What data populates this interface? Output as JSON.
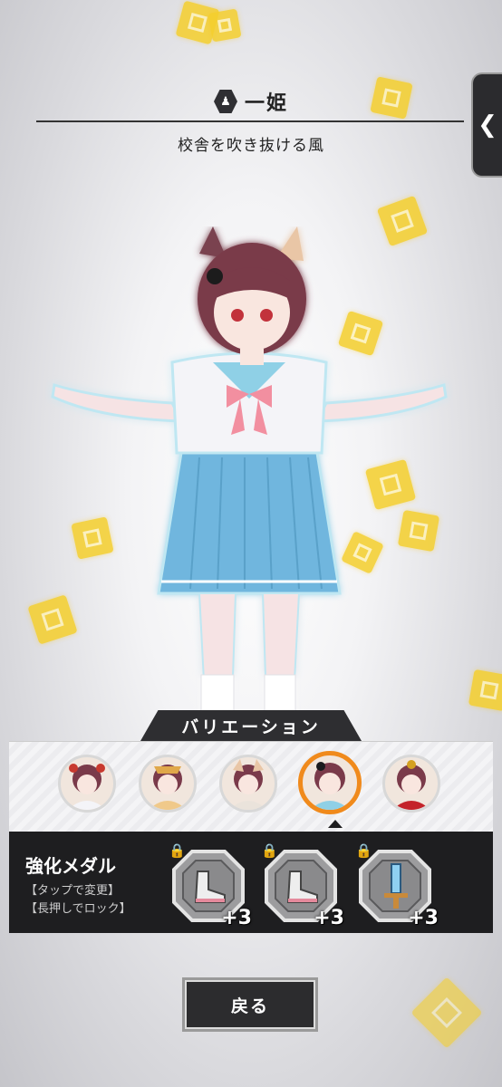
{
  "header": {
    "emblem_icon": "character-class-icon",
    "name": "一姫",
    "title": "校舎を吹き抜ける風"
  },
  "side_tab": {
    "icon": "chevron-left-icon",
    "glyph": "❮"
  },
  "variation": {
    "label": "バリエーション",
    "selected_index": 3,
    "items": [
      {
        "name": "variation-1",
        "accent": "#c8392e"
      },
      {
        "name": "variation-2",
        "accent": "#e0a84a"
      },
      {
        "name": "variation-3",
        "accent": "#7a5a4a"
      },
      {
        "name": "variation-4",
        "accent": "#5a8fbf"
      },
      {
        "name": "variation-5",
        "accent": "#c4232a"
      }
    ]
  },
  "medal": {
    "title": "強化メダル",
    "hint_tap": "【タップで変更】",
    "hint_hold": "【長押しでロック】",
    "slots": [
      {
        "icon": "shoe-icon",
        "level": "+3",
        "locked": true
      },
      {
        "icon": "shoe-icon",
        "level": "+3",
        "locked": true
      },
      {
        "icon": "sword-icon",
        "level": "+3",
        "locked": true
      }
    ]
  },
  "back_button": {
    "label": "戻る"
  },
  "colors": {
    "accent": "#f08a1c",
    "panel": "#1e1e20",
    "card": "#f5cf2c"
  }
}
